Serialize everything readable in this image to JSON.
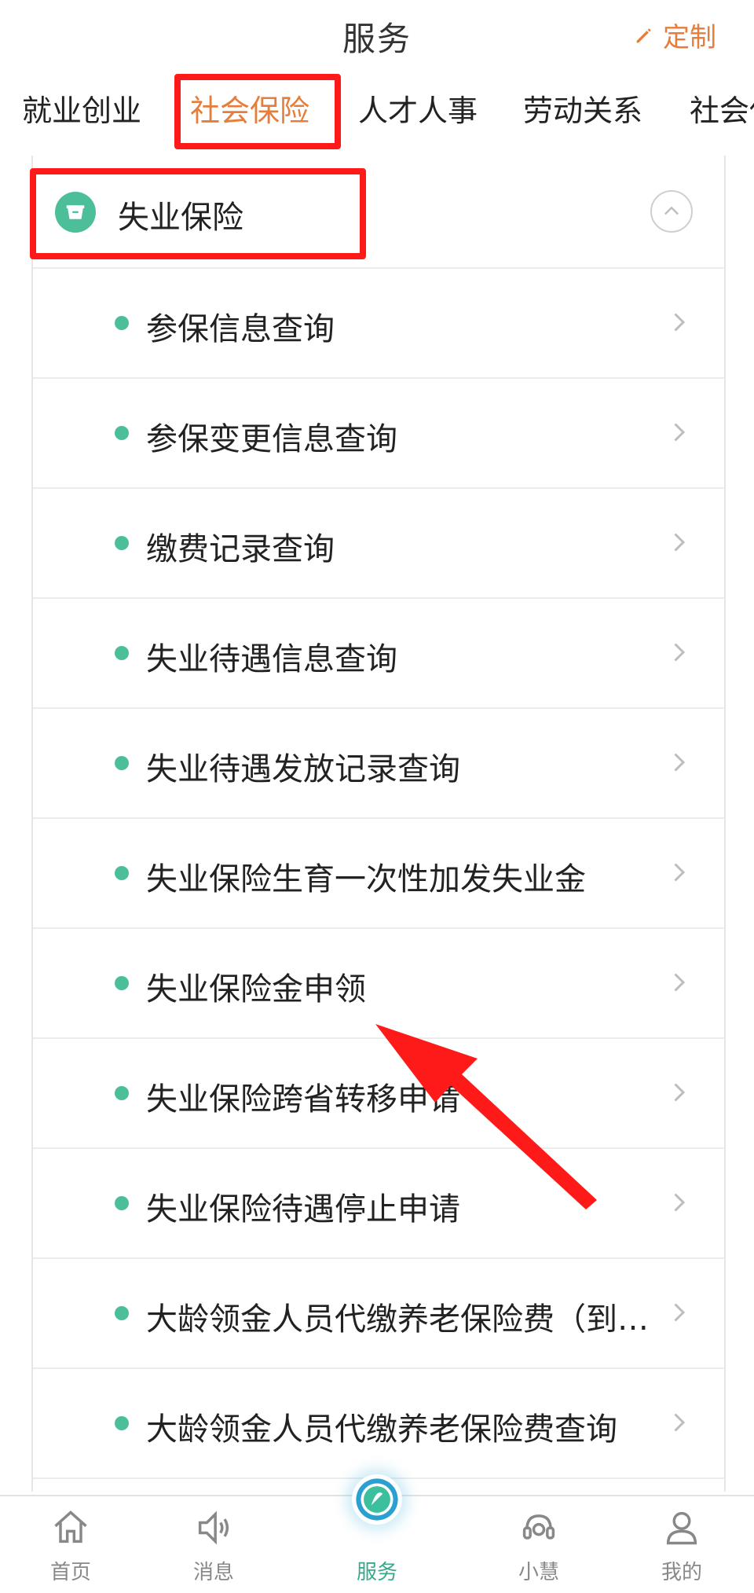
{
  "header": {
    "title": "服务",
    "customize_label": "定制"
  },
  "tabs": [
    {
      "label": "就业创业",
      "active": false
    },
    {
      "label": "社会保险",
      "active": true
    },
    {
      "label": "人才人事",
      "active": false
    },
    {
      "label": "劳动关系",
      "active": false
    },
    {
      "label": "社会保",
      "active": false
    }
  ],
  "section": {
    "title": "失业保险",
    "expanded": true,
    "items": [
      {
        "label": "参保信息查询"
      },
      {
        "label": "参保变更信息查询"
      },
      {
        "label": "缴费记录查询"
      },
      {
        "label": "失业待遇信息查询"
      },
      {
        "label": "失业待遇发放记录查询"
      },
      {
        "label": "失业保险生育一次性加发失业金"
      },
      {
        "label": "失业保险金申领"
      },
      {
        "label": "失业保险跨省转移申请"
      },
      {
        "label": "失业保险待遇停止申请"
      },
      {
        "label": "大龄领金人员代缴养老保险费（到…"
      },
      {
        "label": "大龄领金人员代缴养老保险费查询"
      }
    ]
  },
  "bottom_nav": [
    {
      "label": "首页",
      "icon": "home-icon",
      "active": false
    },
    {
      "label": "消息",
      "icon": "speaker-icon",
      "active": false
    },
    {
      "label": "服务",
      "icon": "service-logo-icon",
      "active": true
    },
    {
      "label": "小慧",
      "icon": "headset-icon",
      "active": false
    },
    {
      "label": "我的",
      "icon": "user-icon",
      "active": false
    }
  ],
  "colors": {
    "accent_orange": "#e67d3a",
    "accent_green": "#4cbf9a",
    "annotation_red": "#ff1a1a"
  }
}
